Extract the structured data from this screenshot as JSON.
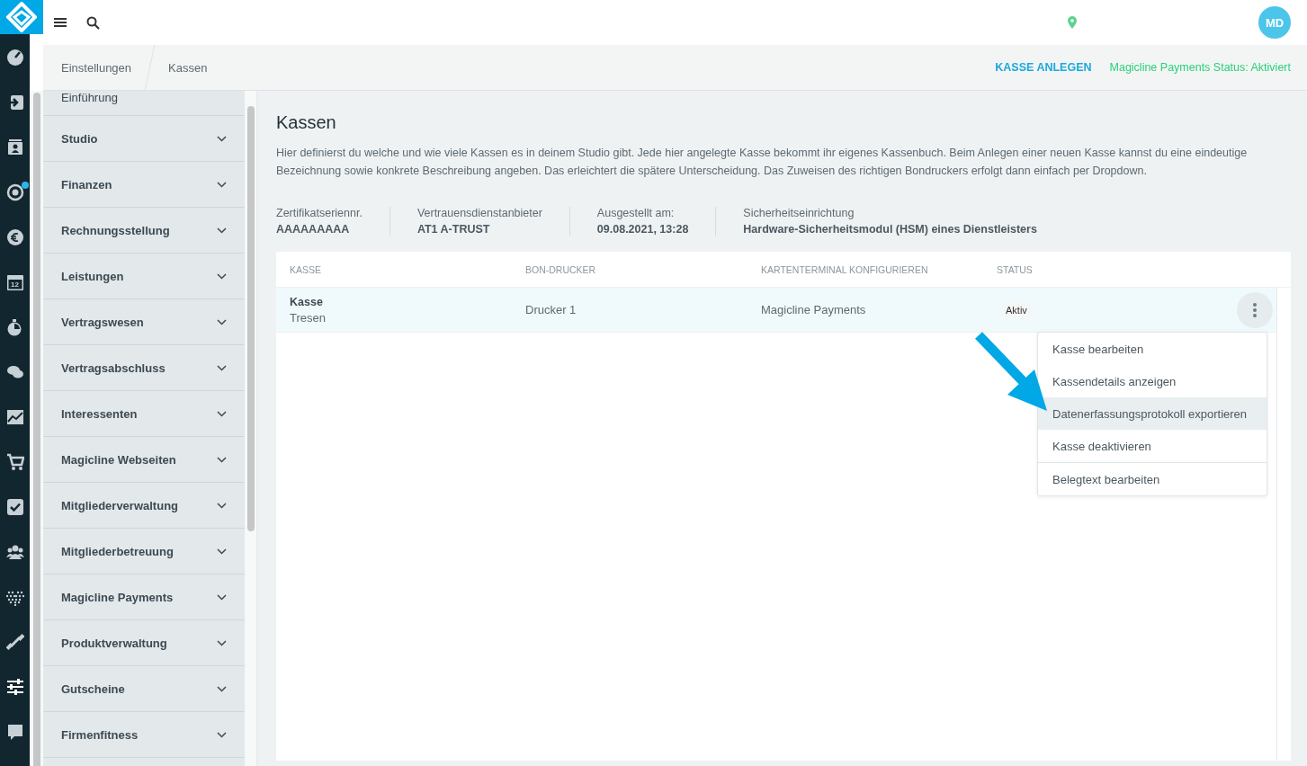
{
  "topbar": {
    "avatar": "MD"
  },
  "rail": [
    {
      "kind": "gauge",
      "selected": false,
      "badge": false
    },
    {
      "kind": "signin",
      "selected": false,
      "badge": false
    },
    {
      "kind": "contact",
      "selected": false,
      "badge": false
    },
    {
      "kind": "target",
      "selected": false,
      "badge": true
    },
    {
      "kind": "euro",
      "selected": false,
      "badge": false
    },
    {
      "kind": "calendar",
      "selected": false,
      "badge": false,
      "label": "12"
    },
    {
      "kind": "stopwatch",
      "selected": false,
      "badge": false
    },
    {
      "kind": "chat",
      "selected": false,
      "badge": false
    },
    {
      "kind": "chart",
      "selected": false,
      "badge": false
    },
    {
      "kind": "cart",
      "selected": false,
      "badge": false
    },
    {
      "kind": "check",
      "selected": false,
      "badge": false
    },
    {
      "kind": "group",
      "selected": false,
      "badge": false
    },
    {
      "kind": "dots",
      "selected": false,
      "badge": false
    },
    {
      "kind": "dumbbell",
      "selected": false,
      "badge": false
    },
    {
      "kind": "sliders",
      "selected": true,
      "badge": false
    },
    {
      "kind": "help",
      "selected": false,
      "badge": false
    }
  ],
  "breadcrumb": [
    "Einstellungen",
    "Kassen"
  ],
  "actions": {
    "create": "KASSE ANLEGEN",
    "status": "Magicline Payments Status: Aktiviert"
  },
  "sidebar": {
    "items": [
      "Einführung",
      "Studio",
      "Finanzen",
      "Rechnungsstellung",
      "Leistungen",
      "Vertragswesen",
      "Vertragsabschluss",
      "Interessenten",
      "Magicline Webseiten",
      "Mitgliederverwaltung",
      "Mitgliederbetreuung",
      "Magicline Payments",
      "Produktverwaltung",
      "Gutscheine",
      "Firmenfitness"
    ]
  },
  "page": {
    "title": "Kassen",
    "description": "Hier definierst du welche und wie viele Kassen es in deinem Studio gibt. Jede hier angelegte Kasse bekommt ihr eigenes Kassenbuch. Beim Anlegen einer neuen Kasse kannst du eine eindeutige Bezeichnung sowie konkrete Beschreibung angeben. Das erleichtert die spätere Unterscheidung. Das Zuweisen des richtigen Bondruckers erfolgt dann einfach per Dropdown."
  },
  "info": [
    {
      "label": "Zertifikatseriennr.",
      "value": "AAAAAAAAA"
    },
    {
      "label": "Vertrauensdienstanbieter",
      "value": "AT1 A-TRUST"
    },
    {
      "label": "Ausgestellt am:",
      "value": "09.08.2021, 13:28"
    },
    {
      "label": "Sicherheitseinrichtung",
      "value": "Hardware-Sicherheitsmodul (HSM) eines Dienstleisters"
    }
  ],
  "table": {
    "columns": [
      "KASSE",
      "BON-DRUCKER",
      "KARTENTERMINAL KONFIGURIEREN",
      "STATUS"
    ],
    "rows": [
      {
        "name": "Kasse",
        "subtitle": "Tresen",
        "printer": "Drucker 1",
        "terminal": "Magicline Payments",
        "status": "Aktiv",
        "selected": true
      }
    ]
  },
  "menu": [
    {
      "label": "Kasse bearbeiten",
      "selected": false,
      "separated": false
    },
    {
      "label": "Kassendetails anzeigen",
      "selected": false,
      "separated": false
    },
    {
      "label": "Datenerfassungsprotokoll exportieren",
      "selected": true,
      "separated": false
    },
    {
      "label": "Kasse deaktivieren",
      "selected": false,
      "separated": false
    },
    {
      "label": "Belegtext bearbeiten",
      "selected": false,
      "separated": true
    }
  ]
}
